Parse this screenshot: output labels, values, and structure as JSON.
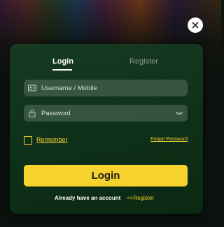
{
  "modal": {
    "tabs": [
      {
        "label": "Login",
        "active": true
      },
      {
        "label": "Register",
        "active": false
      }
    ],
    "username": {
      "placeholder": "Username / Mobile",
      "value": "",
      "icon": "id-card-icon"
    },
    "password": {
      "placeholder": "Password",
      "value": "",
      "icon": "lock-icon",
      "toggle_icon": "eye-closed-icon"
    },
    "remember_label": "Remember",
    "remember_checked": false,
    "forgot_label": "Forgot Password",
    "login_label": "Login",
    "footer_text": "Already have an account",
    "register_link": "<<Register"
  },
  "close_icon": "close-icon",
  "colors": {
    "accent": "#f6d22c",
    "modal_bg": "#133a20",
    "link": "#f2d232",
    "field_bg": "#4a6a55"
  }
}
